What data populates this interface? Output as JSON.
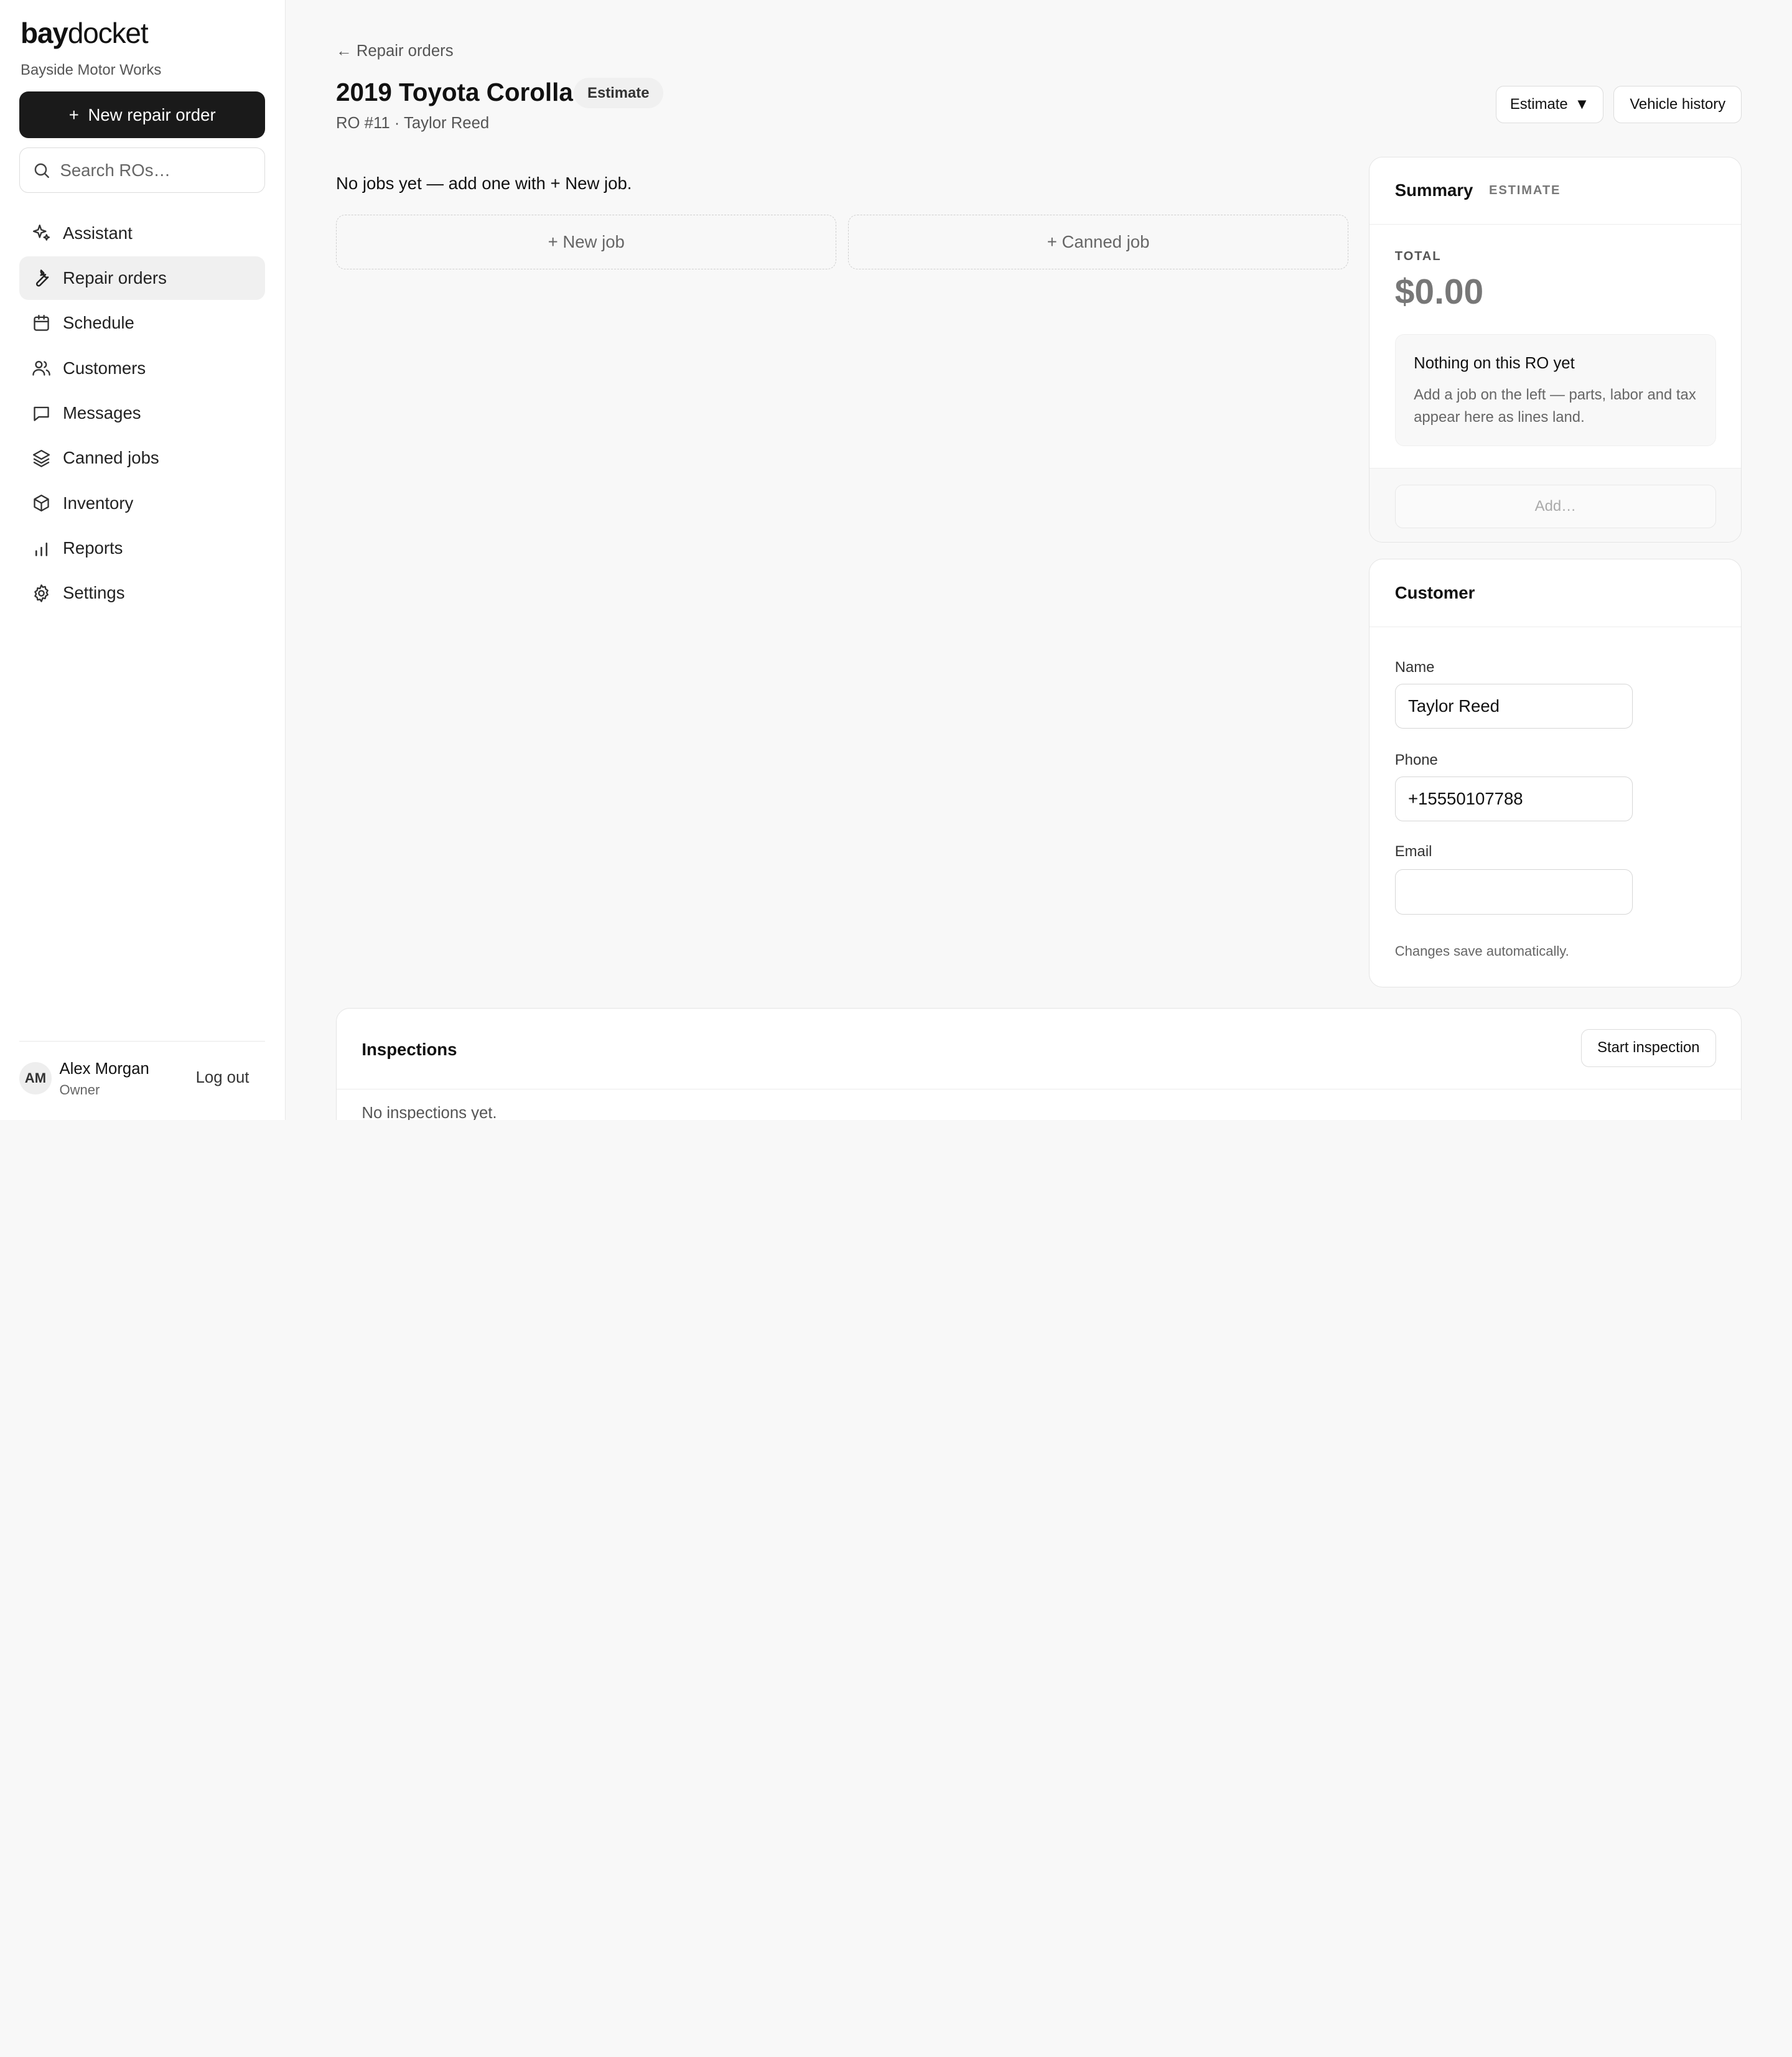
{
  "sidebar": {
    "logo_bold": "bay",
    "logo_rest": "docket",
    "shop_name": "Bayside Motor Works",
    "new_ro_label": "New repair order",
    "new_ro_prefix": "+",
    "search_placeholder": "Search ROs…",
    "nav": [
      {
        "label": "Assistant",
        "icon": "sparkle-icon"
      },
      {
        "label": "Repair orders",
        "icon": "wrench-icon",
        "active": true
      },
      {
        "label": "Schedule",
        "icon": "calendar-icon"
      },
      {
        "label": "Customers",
        "icon": "users-icon"
      },
      {
        "label": "Messages",
        "icon": "message-icon"
      },
      {
        "label": "Canned jobs",
        "icon": "layers-icon"
      },
      {
        "label": "Inventory",
        "icon": "box-icon"
      },
      {
        "label": "Reports",
        "icon": "bar-chart-icon"
      },
      {
        "label": "Settings",
        "icon": "gear-icon"
      }
    ],
    "user": {
      "initials": "AM",
      "name": "Alex Morgan",
      "role": "Owner",
      "logout_label": "Log out"
    }
  },
  "header": {
    "back_label": "← Repair orders",
    "title": "2019 Toyota Corolla",
    "status": "Estimate",
    "subtitle": "RO #11 · Taylor Reed",
    "status_dropdown_label": "Estimate",
    "status_dropdown_caret": "▼",
    "vehicle_history_label": "Vehicle history"
  },
  "jobs": {
    "empty_text": "No jobs yet — add one with + New job.",
    "new_job_label": "+ New job",
    "canned_job_label": "+ Canned job"
  },
  "summary": {
    "title": "Summary",
    "tag": "ESTIMATE",
    "total_label": "TOTAL",
    "total_value": "$0.00",
    "empty_title": "Nothing on this RO yet",
    "empty_body": "Add a job on the left — parts, labor and tax appear here as lines land.",
    "add_placeholder": "Add…"
  },
  "customer": {
    "title": "Customer",
    "name_label": "Name",
    "name_value": "Taylor Reed",
    "phone_label": "Phone",
    "phone_value": "+15550107788",
    "email_label": "Email",
    "email_value": "",
    "autosave_note": "Changes save automatically."
  },
  "inspections": {
    "title": "Inspections",
    "start_label": "Start inspection",
    "empty_text": "No inspections yet."
  },
  "colors": {
    "primary_button": "#1a1a1a",
    "page_background": "#f8f8f8",
    "card_background": "#ffffff",
    "active_nav": "#f0f0f0"
  }
}
